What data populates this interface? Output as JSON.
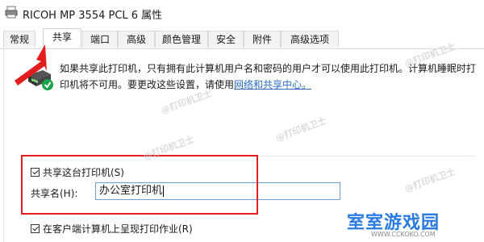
{
  "window": {
    "title": "RICOH MP 3554 PCL 6 属性"
  },
  "tabs": [
    {
      "label": "常规"
    },
    {
      "label": "共享"
    },
    {
      "label": "端口"
    },
    {
      "label": "高级"
    },
    {
      "label": "颜色管理"
    },
    {
      "label": "安全"
    },
    {
      "label": "附件"
    },
    {
      "label": "高级选项"
    }
  ],
  "info": {
    "text": "如果共享此打印机，只有拥有此计算机用户名和密码的用户才可以使用此打印机。计算机睡眠时打印机将不可用。要更改这些设置，请使用",
    "link": "网络和共享中心。"
  },
  "share": {
    "share_checkbox_label": "共享这台打印机(S)",
    "share_name_label": "共享名(H):",
    "share_name_value": "办公室打印机",
    "render_jobs_label": "在客户端计算机上呈现打印作业(R)"
  },
  "watermarks": {
    "text": "@打印机卫士",
    "logo": "室室游戏园",
    "url": "WWW.CCKOKO.COM"
  },
  "colors": {
    "highlight": "#e21d1d",
    "link": "#2b6cc4",
    "arrow": "#e21d1d"
  }
}
